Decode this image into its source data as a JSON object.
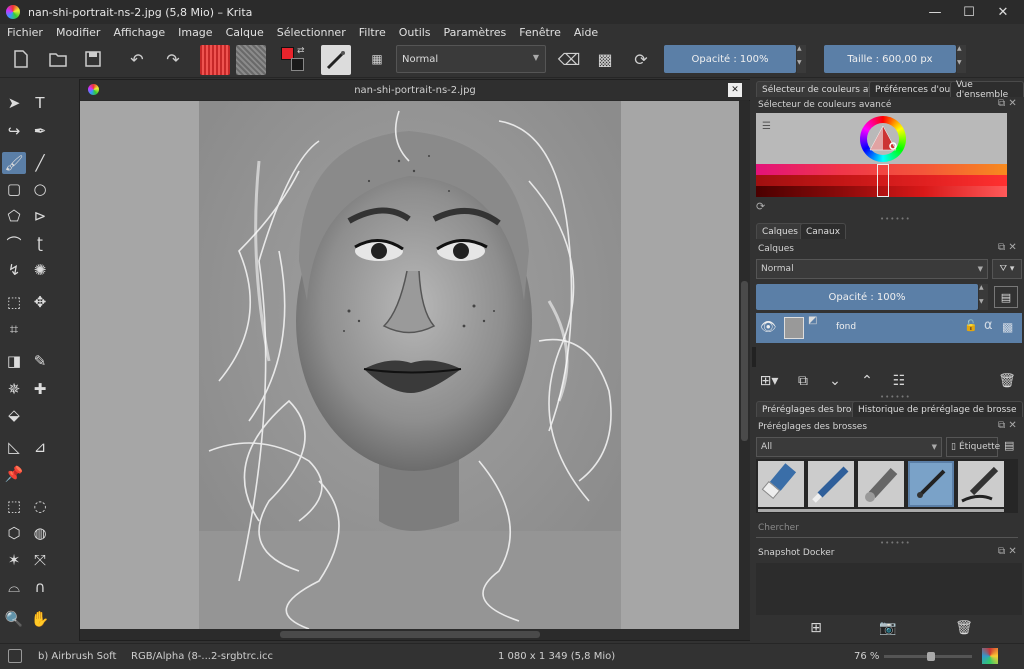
{
  "window": {
    "title": "nan-shi-portrait-ns-2.jpg (5,8 Mio)  –  Krita",
    "minimize": "—",
    "maximize": "☐",
    "close": "✕"
  },
  "menu": [
    "Fichier",
    "Modifier",
    "Affichage",
    "Image",
    "Calque",
    "Sélectionner",
    "Filtre",
    "Outils",
    "Paramètres",
    "Fenêtre",
    "Aide"
  ],
  "toolbar": {
    "blend_mode": "Normal",
    "opacity_label": "Opacité : 100%",
    "size_label": "Taille : 600,00 px"
  },
  "canvas": {
    "document_title": "nan-shi-portrait-ns-2.jpg"
  },
  "dockers": {
    "tabs_top": [
      "Sélecteur de couleurs avancé",
      "Préférences d'outils",
      "Vue d'ensemble"
    ],
    "color_selector_title": "Sélecteur de couleurs avancé",
    "layers_tabs": [
      "Calques",
      "Canaux"
    ],
    "layers_title": "Calques",
    "layer_blend_mode": "Normal",
    "layer_opacity": "Opacité : 100%",
    "layer_name": "fond",
    "brush_tabs": [
      "Préréglages des brosses",
      "Historique de préréglage de brosse"
    ],
    "brush_title": "Préréglages des brosses",
    "brush_filter": "All",
    "brush_tag": "Étiquette",
    "brush_search_placeholder": "Chercher",
    "snapshot_title": "Snapshot Docker"
  },
  "status": {
    "brush": "b) Airbrush Soft",
    "colorspace": "RGB/Alpha (8-...2-srgbtrc.icc",
    "dimensions": "1 080 x 1 349 (5,8 Mio)",
    "zoom": "76 %",
    "zoom_level": 0.76
  },
  "colors": {
    "accent": "#5b7fa7",
    "fg_color": "#e8242c",
    "bg_color": "#1a1a1a"
  }
}
